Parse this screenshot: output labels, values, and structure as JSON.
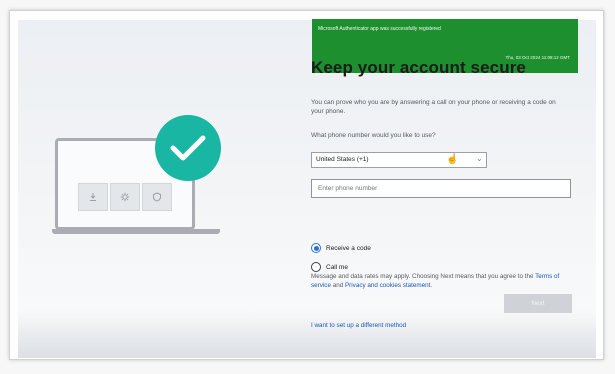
{
  "toast": {
    "message": "Microsoft Authenticator app was successfully registered",
    "timestamp": "Thu, 03 Oct 2024 11:08:12 GMT",
    "color": "#1e8f2f"
  },
  "form": {
    "title": "Keep your account secure",
    "description": "You can prove who you are by answering a call on your phone or receiving a code on your phone.",
    "question": "What phone number would you like to use?",
    "country_value": "United States (+1)",
    "phone_placeholder": "Enter phone number",
    "options": [
      {
        "label": "Receive a code",
        "selected": true
      },
      {
        "label": "Call me",
        "selected": false
      }
    ],
    "disclaimer_prefix": "Message and data rates may apply. Choosing Next means that you agree to the ",
    "terms_link": "Terms of service",
    "and_text": " and ",
    "privacy_link": "Privacy and cookies statement",
    "disclaimer_suffix": ".",
    "next_label": "Next",
    "alt_method_link": "I want to set up a different method"
  },
  "illustration": {
    "check_color": "#19b6a4",
    "icons": [
      "download-icon",
      "gear-icon",
      "shield-icon",
      "checkmark-icon"
    ]
  }
}
